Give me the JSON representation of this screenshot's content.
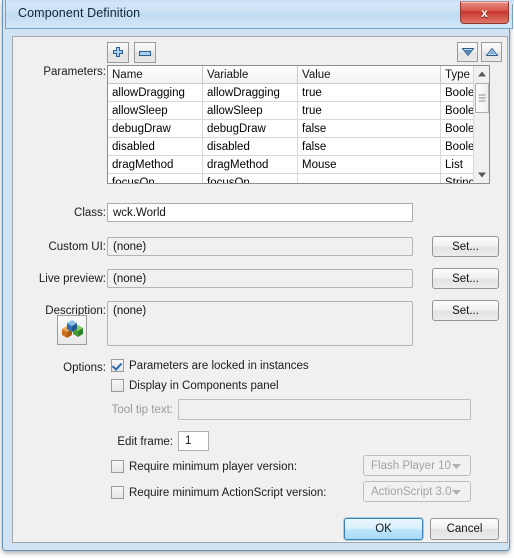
{
  "window": {
    "title": "Component Definition",
    "close_label": "x"
  },
  "toolbar": {
    "add_label": "+",
    "remove_label": "−",
    "move_down_label": "▼",
    "move_up_label": "▲"
  },
  "parameters": {
    "label": "Parameters:",
    "columns": [
      "Name",
      "Variable",
      "Value",
      "Type"
    ],
    "rows": [
      {
        "name": "allowDragging",
        "variable": "allowDragging",
        "value": "true",
        "type": "Boolean"
      },
      {
        "name": "allowSleep",
        "variable": "allowSleep",
        "value": "true",
        "type": "Boolean"
      },
      {
        "name": "debugDraw",
        "variable": "debugDraw",
        "value": "false",
        "type": "Boolean"
      },
      {
        "name": "disabled",
        "variable": "disabled",
        "value": "false",
        "type": "Boolean"
      },
      {
        "name": "dragMethod",
        "variable": "dragMethod",
        "value": "Mouse",
        "type": "List"
      },
      {
        "name": "focusOn",
        "variable": "focusOn",
        "value": "",
        "type": "String"
      }
    ]
  },
  "fields": {
    "class_label": "Class:",
    "class_value": "wck.World",
    "custom_ui_label": "Custom UI:",
    "custom_ui_value": "(none)",
    "live_preview_label": "Live preview:",
    "live_preview_value": "(none)",
    "description_label": "Description:",
    "description_value": "(none)",
    "set_label": "Set..."
  },
  "options": {
    "label": "Options:",
    "locked_in_instances": {
      "label": "Parameters are locked in instances",
      "checked": true
    },
    "display_in_panel": {
      "label": "Display in Components panel",
      "checked": false
    },
    "tooltip": {
      "label": "Tool tip text:",
      "value": "",
      "enabled": false
    },
    "edit_frame": {
      "label": "Edit frame:",
      "value": "1"
    },
    "require_player": {
      "label": "Require minimum player version:",
      "checked": false,
      "value": "Flash Player 10"
    },
    "require_actionscript": {
      "label": "Require minimum ActionScript version:",
      "checked": false,
      "value": "ActionScript 3.0"
    }
  },
  "footer": {
    "ok_label": "OK",
    "cancel_label": "Cancel"
  },
  "colors": {
    "title_bar": "#cce1f4",
    "close_red": "#c7342a",
    "default_btn_blue": "#bee6fd",
    "client_bg": "#f0f0f0"
  }
}
